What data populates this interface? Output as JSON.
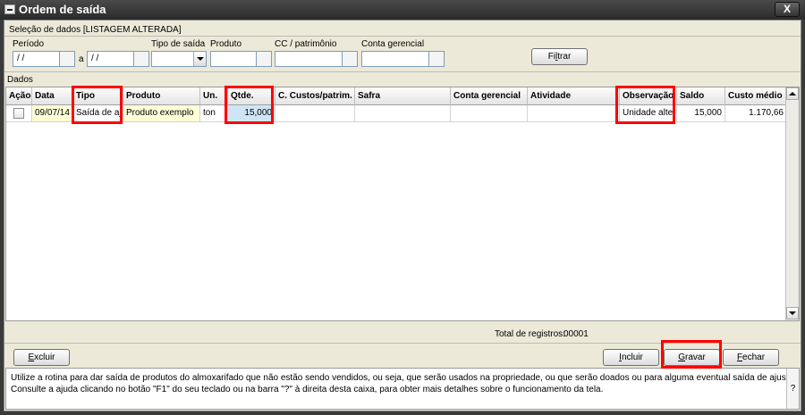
{
  "window": {
    "title": "Ordem de saída",
    "close_label": "X"
  },
  "selection": {
    "header": "Seleção de dados [LISTAGEM ALTERADA]",
    "periodo_label": "Período",
    "periodo_start": " / /",
    "periodo_sep": "a",
    "periodo_end": " / /",
    "tipo_label": "Tipo de saída",
    "tipo_value": "",
    "produto_label": "Produto",
    "produto_value": "",
    "cc_label": "CC / patrimônio",
    "cc_value": "",
    "conta_label": "Conta gerencial",
    "conta_value": "",
    "filtrar_pre": "Fi",
    "filtrar_key": "l",
    "filtrar_post": "trar"
  },
  "dados_label": "Dados",
  "table": {
    "columns": [
      "Ação",
      "Data",
      "Tipo",
      "Produto",
      "Un.",
      "Qtde.",
      "C. Custos/patrim.",
      "Safra",
      "Conta gerencial",
      "Atividade",
      "Observação",
      "Saldo",
      "Custo médio"
    ],
    "rows": [
      {
        "acao": "",
        "data": "09/07/14",
        "tipo": "Saída de ajuste",
        "produto": "Produto exemplo",
        "un": "ton",
        "qtde": "15,000",
        "cc": "",
        "safra": "",
        "conta": "",
        "atividade": "",
        "observacao": "Unidade alterada",
        "saldo": "15,000",
        "custo_medio": "1.170,66"
      }
    ]
  },
  "totals": {
    "label": "Total de registros:",
    "value": "00001"
  },
  "buttons": {
    "excluir_key": "E",
    "excluir_rest": "xcluir",
    "incluir_key": "I",
    "incluir_rest": "ncluir",
    "gravar_key": "G",
    "gravar_rest": "ravar",
    "fechar_key": "F",
    "fechar_rest": "echar"
  },
  "help": {
    "line1": "Utilize a rotina para dar saída de produtos do almoxarifado que não estão sendo vendidos, ou seja, que serão usados na propriedade, ou que serão doados ou para alguma eventual saída de ajuste.",
    "line2": "Consulte a ajuda clicando no botão \"F1\" do seu teclado ou na barra \"?\" à direita desta caixa, para obter mais detalhes sobre o funcionamento da tela.",
    "question": "?"
  },
  "colors": {
    "highlight": "#ff0000",
    "row_yellow": "#ffffd8",
    "row_blue": "#cfe5f7"
  }
}
